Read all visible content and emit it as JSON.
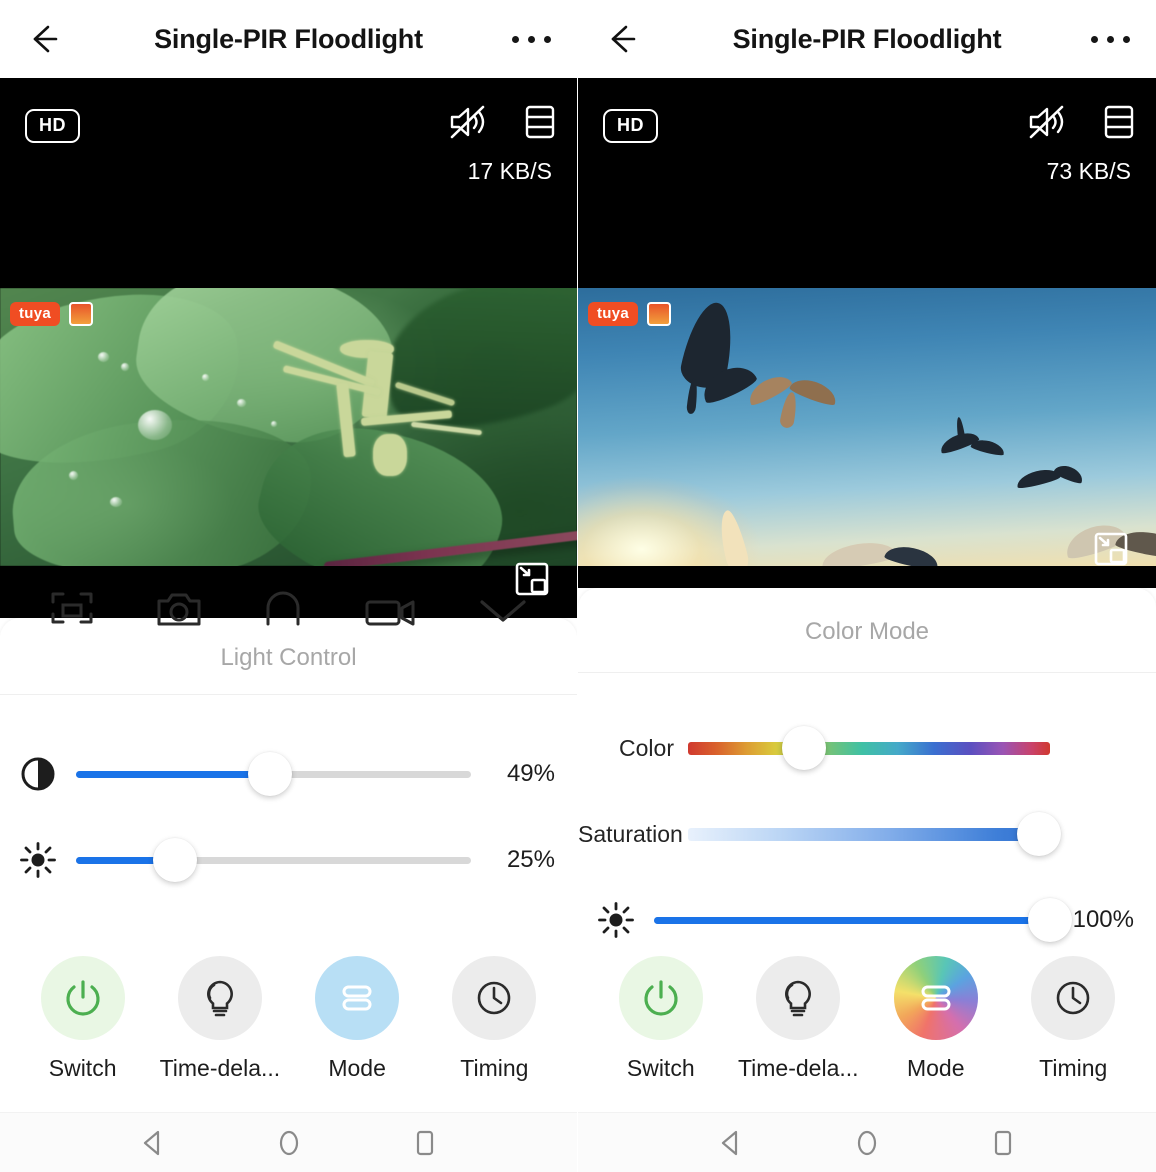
{
  "app": {
    "title": "Single-PIR Floodlight",
    "back_icon": "arrow-left-icon",
    "more_icon": "more-options-icon"
  },
  "panels": [
    {
      "id": "left",
      "appbar": {
        "title": "Single-PIR Floodlight"
      },
      "video": {
        "quality_badge": "HD",
        "mute_icon": "speaker-muted-icon",
        "layout_icon": "split-screen-icon",
        "bitrate": "17 KB/S",
        "pip_icon": "picture-in-picture-icon",
        "watermark": "tuya",
        "scene": "macro video of a green mantis on wet leaves"
      },
      "quick_actions": [
        {
          "name": "fullscreen-icon"
        },
        {
          "name": "screenshot-icon"
        },
        {
          "name": "talk-icon"
        },
        {
          "name": "record-icon"
        },
        {
          "name": "collapse-chevron-icon"
        }
      ],
      "sheet": {
        "title": "Light Control",
        "sliders": [
          {
            "name": "contrast",
            "icon": "contrast-icon",
            "label": "",
            "value": 49,
            "value_text": "49%",
            "type": "solid"
          },
          {
            "name": "brightness",
            "icon": "brightness-icon",
            "label": "",
            "value": 25,
            "value_text": "25%",
            "type": "solid"
          }
        ]
      },
      "actions": [
        {
          "name": "switch",
          "label": "Switch",
          "icon": "power-icon",
          "style": "green"
        },
        {
          "name": "time-delay",
          "label": "Time-dela...",
          "icon": "bulb-icon",
          "style": "grey"
        },
        {
          "name": "mode",
          "label": "Mode",
          "icon": "mode-bars-icon",
          "style": "blue"
        },
        {
          "name": "timing",
          "label": "Timing",
          "icon": "clock-icon",
          "style": "grey"
        }
      ]
    },
    {
      "id": "right",
      "appbar": {
        "title": "Single-PIR Floodlight"
      },
      "video": {
        "quality_badge": "HD",
        "mute_icon": "speaker-muted-icon",
        "layout_icon": "split-screen-icon",
        "bitrate": "73 KB/S",
        "pip_icon": "picture-in-picture-icon",
        "watermark": "tuya",
        "scene": "seagulls flying against a sunset sky"
      },
      "quick_actions": [],
      "sheet": {
        "title": "Color Mode",
        "sliders": [
          {
            "name": "color",
            "icon": "",
            "label": "Color",
            "value": 32,
            "value_text": "",
            "type": "hue"
          },
          {
            "name": "saturation",
            "icon": "",
            "label": "Saturation",
            "value": 97,
            "value_text": "",
            "type": "sat"
          },
          {
            "name": "brightness",
            "icon": "brightness-icon",
            "label": "",
            "value": 100,
            "value_text": "100%",
            "type": "solid"
          }
        ]
      },
      "actions": [
        {
          "name": "switch",
          "label": "Switch",
          "icon": "power-icon",
          "style": "green"
        },
        {
          "name": "time-delay",
          "label": "Time-dela...",
          "icon": "bulb-icon",
          "style": "grey"
        },
        {
          "name": "mode",
          "label": "Mode",
          "icon": "mode-bars-icon",
          "style": "rainbow"
        },
        {
          "name": "timing",
          "label": "Timing",
          "icon": "clock-icon",
          "style": "grey"
        }
      ]
    }
  ],
  "navbar": {
    "back": "nav-back-icon",
    "home": "nav-home-icon",
    "recents": "nav-recents-icon"
  },
  "colors": {
    "accent_blue": "#1a73e8",
    "switch_green": "#4caf50",
    "mode_blue_bg": "#b8dff5",
    "bubble_grey": "#ececec",
    "tuya_orange": "#f04d23"
  }
}
